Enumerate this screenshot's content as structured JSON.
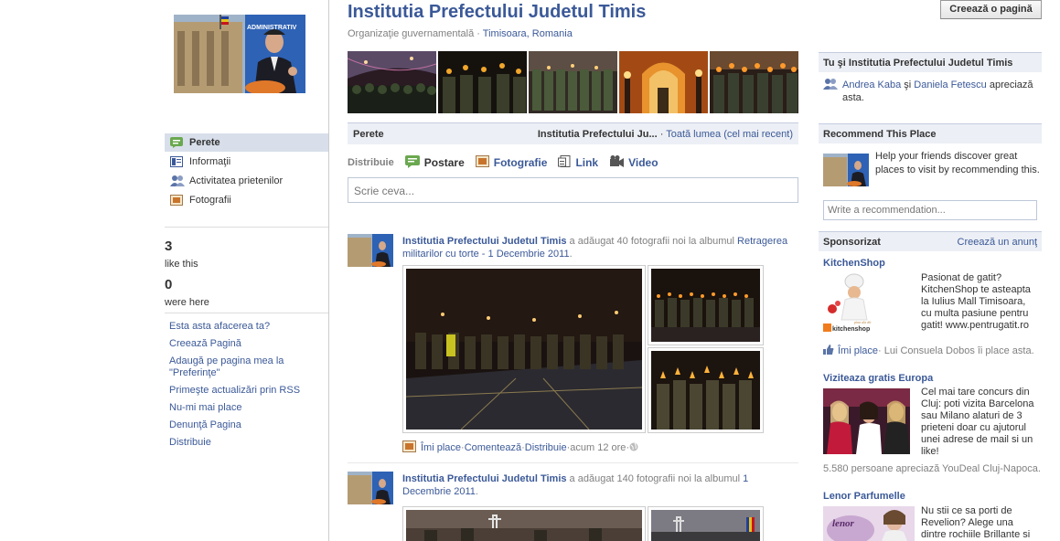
{
  "page": {
    "title": "Institutia Prefectului Judetul Timis",
    "category": "Organizaţie guvernamentală",
    "location": "Timisoara, Romania",
    "create_page_button": "Creează o pagină"
  },
  "profile_sign_text": "ADMINISTRATIV",
  "left_nav": [
    {
      "label": "Perete",
      "icon": "wall-icon"
    },
    {
      "label": "Informaţii",
      "icon": "info-icon"
    },
    {
      "label": "Activitatea prietenilor",
      "icon": "friends-icon"
    },
    {
      "label": "Fotografii",
      "icon": "photos-icon"
    }
  ],
  "stats": {
    "likes": "3",
    "likes_label": "like this",
    "checkins": "0",
    "checkins_label": "were here"
  },
  "left_links": [
    "Esta asta afacerea ta?",
    "Creează Pagină",
    "Adaugă pe pagina mea la \"Preferinţe\"",
    "Primeşte actualizări prin RSS",
    "Nu-mi mai place",
    "Denunţă Pagina",
    "Distribuie"
  ],
  "wall_bar": {
    "label": "Perete",
    "filter_name": "Institutia Prefectului Ju...",
    "separator": " · ",
    "filter_all": "Toată lumea (cel mai recent)"
  },
  "composer": {
    "share_label": "Distribuie",
    "tabs": [
      {
        "label": "Postare",
        "icon": "status-icon"
      },
      {
        "label": "Fotografie",
        "icon": "photo-icon"
      },
      {
        "label": "Link",
        "icon": "link-icon"
      },
      {
        "label": "Video",
        "icon": "video-icon"
      }
    ],
    "placeholder": "Scrie ceva..."
  },
  "stories": [
    {
      "actor": "Institutia Prefectului Judetul Timis",
      "action": " a adăugat 40 fotografii noi la albumul ",
      "album": "Retragerea militarilor cu torte - 1 Decembrie 2011",
      "tail": ".",
      "like": "Îmi place",
      "comment": "Comentează",
      "share": "Distribuie",
      "time": "acum 12 ore",
      "dot": " · "
    },
    {
      "actor": "Institutia Prefectului Judetul Timis",
      "action": " a adăugat 140 fotografii noi la albumul ",
      "album": "1 Decembrie 2011",
      "tail": "."
    }
  ],
  "right": {
    "you_and": {
      "header": "Tu şi Institutia Prefectului Judetul Timis",
      "friend1": "Andrea Kaba",
      "and": " şi ",
      "friend2": "Daniela Fetescu",
      "rest": " apreciază asta."
    },
    "recommend": {
      "header": "Recommend This Place",
      "text": "Help your friends discover great places to visit by recommending this.",
      "placeholder": "Write a recommendation..."
    },
    "sponsored": {
      "header": "Sponsorizat",
      "create_ad": "Creează un anunţ",
      "ads": [
        {
          "title": "KitchenShop",
          "text": "Pasionat de gatit? KitchenShop te asteapta la Iulius Mall Timisoara, cu multa pasiune pentru gatit! www.pentrugatit.ro",
          "brand": "kitchenshop",
          "tagline": "pina ala dit",
          "like": "Îmi place",
          "social": " · Lui Consuela Dobos îi place asta."
        },
        {
          "title": "Viziteaza gratis Europa",
          "text": "Cel mai tare concurs din Cluj: poti vizita Barcelona sau Milano alaturi de 3 prieteni doar cu ajutorul unei adrese de mail si un like!",
          "social": "5.580 persoane apreciază YouDeal Cluj-Napoca."
        },
        {
          "title": "Lenor Parfumelle",
          "text": "Nu stii ce sa porti de Revelion? Alege una dintre rochiile Brillante si",
          "brand": "lenor"
        }
      ]
    }
  },
  "colors": {
    "link": "#3b5998",
    "header_bg": "#eceff5",
    "nav_active": "#d8dfea"
  }
}
